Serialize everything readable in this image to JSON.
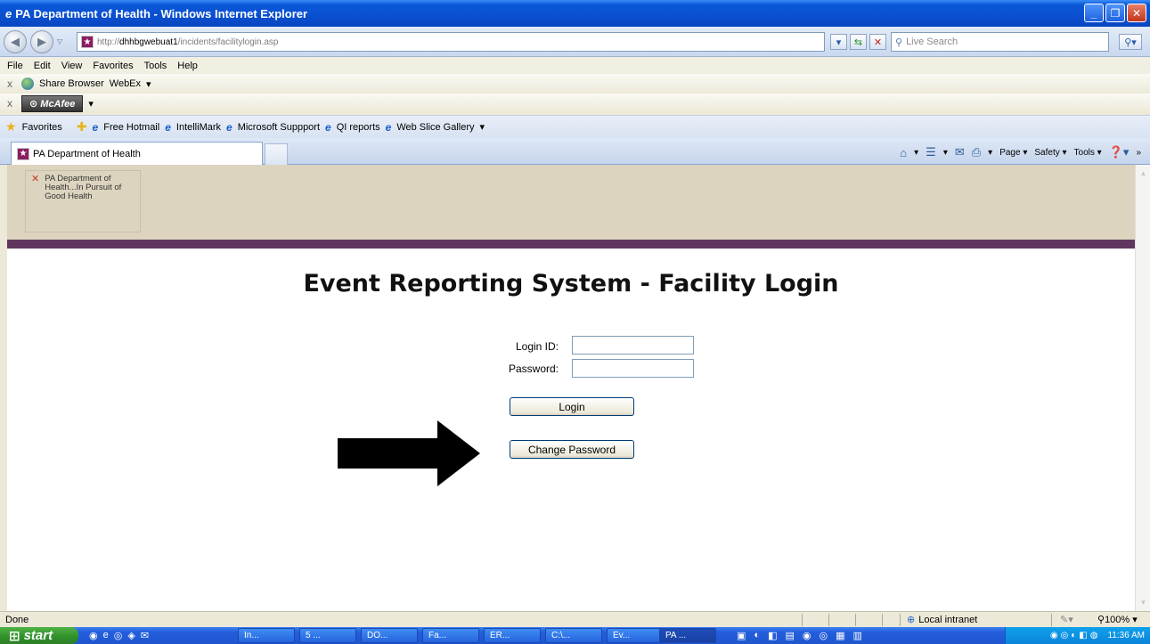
{
  "window": {
    "title": "PA Department of Health - Windows Internet Explorer",
    "buttons": [
      "_",
      "❐",
      "✕"
    ]
  },
  "address": {
    "url_prefix": "http://",
    "url_host": "dhhbgwebuat1",
    "url_path": "/incidents/facilitylogin.asp",
    "search_placeholder": "Live Search"
  },
  "menu": [
    "File",
    "Edit",
    "View",
    "Favorites",
    "Tools",
    "Help"
  ],
  "toolbar1": {
    "share_label": "Share Browser",
    "webex_label": "WebEx"
  },
  "toolbar2": {
    "mcafee_label": "McAfee"
  },
  "favorites": {
    "label": "Favorites",
    "items": [
      "Free Hotmail",
      "IntelliMark",
      "Microsoft Suppport",
      "QI reports",
      "Web Slice Gallery"
    ]
  },
  "tab": {
    "title": "PA Department of Health"
  },
  "command_bar": {
    "page": "Page",
    "safety": "Safety",
    "tools": "Tools"
  },
  "page": {
    "banner_alt": "PA Department of Health...In Pursuit of Good Health",
    "heading": "Event Reporting System - Facility Login",
    "login_label": "Login ID:",
    "password_label": "Password:",
    "login_value": "",
    "password_value": "",
    "login_button": "Login",
    "change_password_button": "Change Password"
  },
  "status": {
    "text": "Done",
    "zone": "Local intranet",
    "zoom": "100%"
  },
  "taskbar": {
    "start": "start",
    "tasks": [
      "In...",
      "5 ...",
      "DO...",
      "Fa...",
      "ER...",
      "C:\\...",
      "Ev...",
      "PA ..."
    ],
    "active_task": "PA ...",
    "clock": "11:36 AM"
  },
  "colors": {
    "banner": "#dcd4bf",
    "purple_band": "#60375e",
    "xp_blue": "#0a4fd0"
  }
}
